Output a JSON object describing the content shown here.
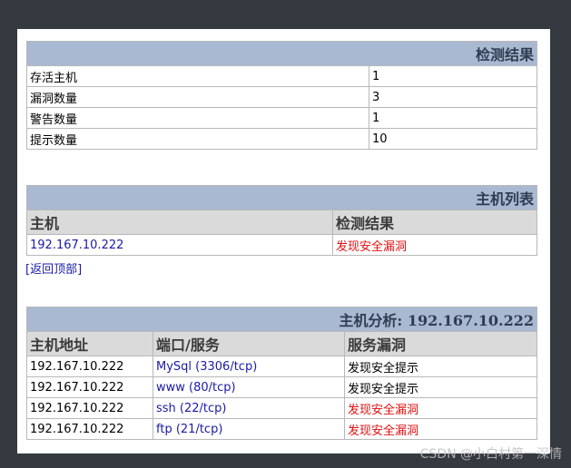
{
  "summary": {
    "title": "检测结果",
    "rows": [
      {
        "label": "存活主机",
        "value": "1"
      },
      {
        "label": "漏洞数量",
        "value": "3"
      },
      {
        "label": "警告数量",
        "value": "1"
      },
      {
        "label": "提示数量",
        "value": "10"
      }
    ]
  },
  "host_list": {
    "title": "主机列表",
    "col_host": "主机",
    "col_result": "检测结果",
    "rows": [
      {
        "host": "192.167.10.222",
        "result": "发现安全漏洞"
      }
    ]
  },
  "back_link": "[返回顶部]",
  "host_analysis": {
    "title": "主机分析: 192.167.10.222",
    "col_address": "主机地址",
    "col_port": "端口/服务",
    "col_vuln": "服务漏洞",
    "rows": [
      {
        "address": "192.167.10.222",
        "port": "MySql (3306/tcp)",
        "vuln": "发现安全提示",
        "severity": "info"
      },
      {
        "address": "192.167.10.222",
        "port": "www (80/tcp)",
        "vuln": "发现安全提示",
        "severity": "info"
      },
      {
        "address": "192.167.10.222",
        "port": "ssh (22/tcp)",
        "vuln": "发现安全漏洞",
        "severity": "danger"
      },
      {
        "address": "192.167.10.222",
        "port": "ftp (21/tcp)",
        "vuln": "发现安全漏洞",
        "severity": "danger"
      }
    ]
  },
  "watermark": "CSDN @小白村第一深情",
  "colors": {
    "section_header_bg": "#a9b9d1",
    "column_header_bg": "#dadada",
    "link": "#1a1aa6",
    "danger": "#e01010",
    "backdrop": "#353a40"
  }
}
